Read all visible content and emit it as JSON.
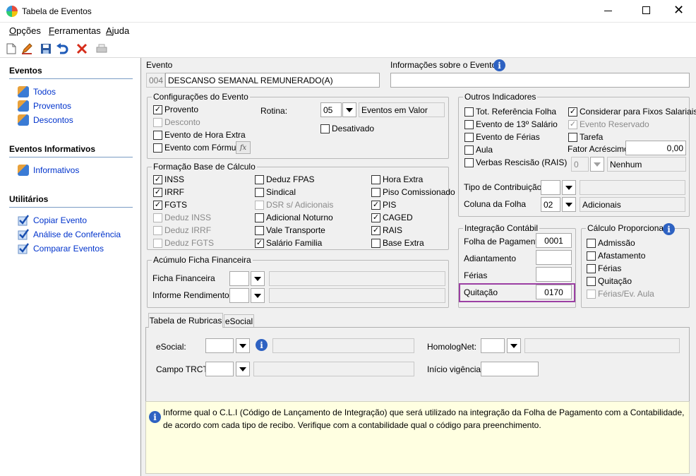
{
  "window": {
    "title": "Tabela de Eventos"
  },
  "menu": [
    {
      "accel": "O",
      "rest": "pções"
    },
    {
      "accel": "F",
      "rest": "erramentas"
    },
    {
      "accel": "A",
      "rest": "juda"
    }
  ],
  "sidebar": {
    "sections": [
      {
        "title": "Eventos",
        "items": [
          "Todos",
          "Proventos",
          "Descontos"
        ]
      },
      {
        "title": "Eventos Informativos",
        "items": [
          "Informativos"
        ]
      },
      {
        "title": "Utilitários",
        "items": [
          "Copiar Evento",
          "Análise de Conferência",
          "Comparar Eventos"
        ]
      }
    ]
  },
  "evento": {
    "label": "Evento",
    "code": "004",
    "name": "DESCANSO SEMANAL REMUNERADO(A)",
    "info_label": "Informações sobre o Evento"
  },
  "config": {
    "title": "Configurações do Evento",
    "provento": "Provento",
    "desconto": "Desconto",
    "hora_extra": "Evento de Hora Extra",
    "formula": "Evento com Fórmula",
    "rotina_label": "Rotina:",
    "rotina_value": "05",
    "rotina_desc": "Eventos em Valor",
    "desativado": "Desativado"
  },
  "base": {
    "title": "Formação Base de Cálculo",
    "col1": [
      "INSS",
      "IRRF",
      "FGTS",
      "Deduz INSS",
      "Deduz IRRF",
      "Deduz FGTS"
    ],
    "col2": [
      "Deduz FPAS",
      "Sindical",
      "DSR s/ Adicionais",
      "Adicional Noturno",
      "Vale Transporte",
      "Salário Familia"
    ],
    "col3": [
      "Hora Extra",
      "Piso Comissionado",
      "PIS",
      "CAGED",
      "RAIS",
      "Base Extra"
    ]
  },
  "acumulo": {
    "title": "Acúmulo Ficha Financeira",
    "ficha": "Ficha Financeira",
    "informe": "Informe Rendimentos"
  },
  "outros": {
    "title": "Outros Indicadores",
    "left": [
      "Tot. Referência Folha",
      "Evento de 13º Salário",
      "Evento de Férias",
      "Aula",
      "Verbas Rescisão (RAIS)"
    ],
    "right": [
      "Considerar para Fixos Salariais",
      "Evento Reservado",
      "Tarefa"
    ],
    "fator_label": "Fator Acréscimo",
    "fator_value": "0,00",
    "verbas_value": "0",
    "verbas_desc": "Nenhum",
    "tipo_label": "Tipo de Contribuição",
    "coluna_label": "Coluna da Folha",
    "coluna_value": "02",
    "coluna_desc": "Adicionais"
  },
  "integracao": {
    "title": "Integração Contábil",
    "rows": [
      {
        "label": "Folha de Pagamento",
        "value": "0001"
      },
      {
        "label": "Adiantamento",
        "value": ""
      },
      {
        "label": "Férias",
        "value": ""
      },
      {
        "label": "Quitação",
        "value": "0170"
      }
    ],
    "highlight_color": "#9b3fa3"
  },
  "proporcional": {
    "title": "Cálculo Proporcional",
    "items": [
      "Admissão",
      "Afastamento",
      "Férias",
      "Quitação",
      "Férias/Ev. Aula"
    ]
  },
  "tabs": [
    "Tabela de Rubricas",
    "eSocial"
  ],
  "rubricas": {
    "esocial": "eSocial:",
    "homolognet": "HomologNet:",
    "campo_trct": "Campo TRCT:",
    "inicio": "Início vigência:"
  },
  "hint": {
    "text": "Informe qual o C.L.I (Código de Lançamento de Integração) que será utilizado na integração da Folha de Pagamento com a Contabilidade, de acordo com cada tipo de recibo. Verifique com a contabilidade qual o código para preenchimento.",
    "bg": "#ffffe1"
  }
}
